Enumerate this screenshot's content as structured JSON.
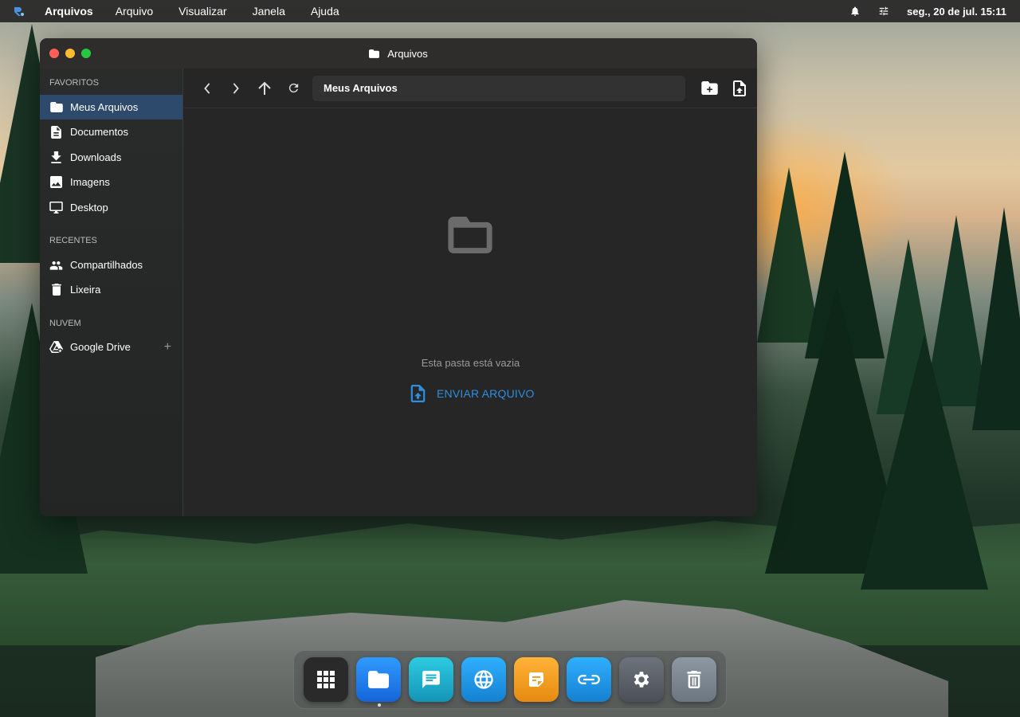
{
  "menubar": {
    "app_name": "Arquivos",
    "menus": [
      "Arquivo",
      "Visualizar",
      "Janela",
      "Ajuda"
    ],
    "clock": "seg., 20 de jul. 15:11",
    "icons": [
      "notification-bell-icon",
      "settings-sliders-icon"
    ]
  },
  "window": {
    "title": "Arquivos",
    "traffic_colors": [
      "#ff5f57",
      "#febc2e",
      "#28c840"
    ]
  },
  "sidebar": {
    "sections": [
      {
        "label": "FAVORITOS",
        "items": [
          {
            "label": "Meus Arquivos",
            "icon": "folder-icon",
            "active": true
          },
          {
            "label": "Documentos",
            "icon": "document-icon"
          },
          {
            "label": "Downloads",
            "icon": "download-icon"
          },
          {
            "label": "Imagens",
            "icon": "image-icon"
          },
          {
            "label": "Desktop",
            "icon": "monitor-icon"
          }
        ]
      },
      {
        "label": "RECENTES",
        "items": [
          {
            "label": "Compartilhados",
            "icon": "people-icon"
          },
          {
            "label": "Lixeira",
            "icon": "trash-icon"
          }
        ]
      },
      {
        "label": "NUVEM",
        "items": [
          {
            "label": "Google Drive",
            "icon": "google-drive-icon",
            "action": "+"
          }
        ]
      }
    ]
  },
  "toolbar": {
    "path": "Meus Arquivos"
  },
  "empty_state": {
    "message": "Esta pasta está vazia",
    "upload_label": "ENVIAR ARQUIVO"
  },
  "dock": {
    "apps": [
      {
        "name": "app-grid-icon",
        "color": "#2a2a2a"
      },
      {
        "name": "files-icon",
        "color": "#1e88e5"
      },
      {
        "name": "messages-icon",
        "color": "#1fb5c8"
      },
      {
        "name": "browser-icon",
        "color": "#1e9be0"
      },
      {
        "name": "notes-icon",
        "color": "#f2a024"
      },
      {
        "name": "links-icon",
        "color": "#1f9be2"
      },
      {
        "name": "settings-icon",
        "color": "#5b6068"
      },
      {
        "name": "trash-icon",
        "color": "#7a8590"
      }
    ]
  },
  "colors": {
    "accent": "#2f8ee0",
    "sidebar_active": "#2d4a6c"
  }
}
